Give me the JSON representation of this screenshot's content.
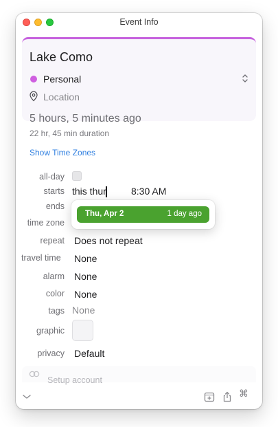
{
  "window": {
    "title": "Event Info"
  },
  "event": {
    "title": "Lake Como",
    "calendar": "Personal",
    "calendar_color": "#cf5fe0",
    "location_placeholder": "Location"
  },
  "summary": {
    "relative": "5 hours, 5 minutes ago",
    "duration": "22 hr, 45 min duration",
    "show_time_zones": "Show Time Zones"
  },
  "fields": {
    "all_day": {
      "label": "all-day",
      "checked": false
    },
    "starts": {
      "label": "starts",
      "date_input": "this thur",
      "time": "8:30 AM"
    },
    "ends": {
      "label": "ends"
    },
    "time_zone": {
      "label": "time zone"
    },
    "repeat": {
      "label": "repeat",
      "value": "Does not repeat"
    },
    "travel_time": {
      "label": "travel time",
      "value": "None"
    },
    "alarm": {
      "label": "alarm",
      "value": "None"
    },
    "color": {
      "label": "color",
      "value": "None"
    },
    "tags": {
      "label": "tags",
      "value": "None"
    },
    "graphic": {
      "label": "graphic"
    },
    "privacy": {
      "label": "privacy",
      "value": "Default"
    }
  },
  "date_suggestion": {
    "date": "Thu, Apr 2",
    "relative": "1 day ago",
    "color": "#4aa22f"
  },
  "account": {
    "text": "Setup account"
  },
  "bottom_bar": {
    "collapse_icon": "chevron-down-icon",
    "icons": [
      "add-to-calendar-icon",
      "share-icon",
      "command-icon"
    ]
  }
}
